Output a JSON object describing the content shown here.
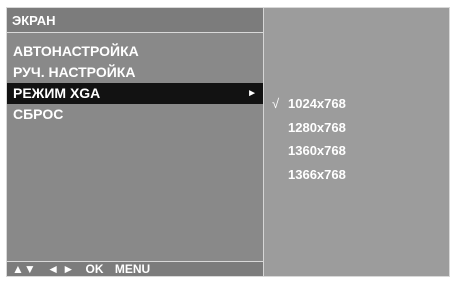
{
  "title": "ЭКРАН",
  "menu": [
    {
      "label": "АВТОНАСТРОЙКА"
    },
    {
      "label": "РУЧ. НАСТРОЙКА"
    },
    {
      "label": "РЕЖИМ XGA",
      "arrow": "►"
    },
    {
      "label": "СБРОС"
    }
  ],
  "footer": {
    "updown": "▲▼",
    "leftright": "◄ ►",
    "ok": "OK",
    "menu": "MENU"
  },
  "options": [
    {
      "label": "1024x768",
      "check": "√"
    },
    {
      "label": "1280x768"
    },
    {
      "label": "1360x768"
    },
    {
      "label": "1366x768"
    }
  ],
  "colors": {
    "panel_bg": "#9c9c9c",
    "left_panel_bg": "#898989",
    "selected_bg": "#121212"
  }
}
